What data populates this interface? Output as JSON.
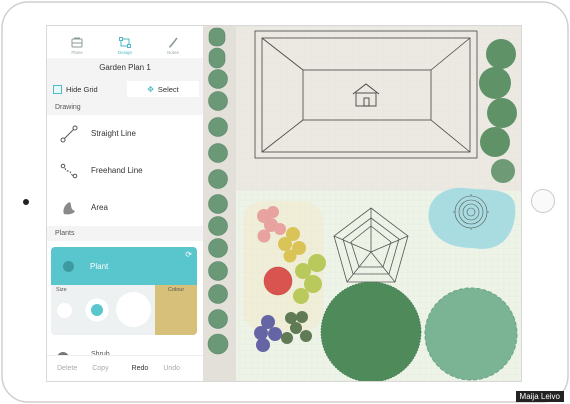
{
  "tabs": [
    {
      "label": "Plans",
      "icon": "plans-icon"
    },
    {
      "label": "Design",
      "icon": "design-icon"
    },
    {
      "label": "Notes",
      "icon": "notes-icon"
    }
  ],
  "plan_title": "Garden Plan 1",
  "hide_grid_label": "Hide Grid",
  "select_label": "Select",
  "drawing_section": "Drawing",
  "tools": [
    {
      "label": "Straight Line",
      "icon": "straight-line-icon"
    },
    {
      "label": "Freehand Line",
      "icon": "freehand-line-icon"
    },
    {
      "label": "Area",
      "icon": "area-icon"
    }
  ],
  "plants_section": "Plants",
  "plant": {
    "label": "Plant",
    "size_label": "Size",
    "colour_label": "Colour",
    "colour": "#d6c07a",
    "accent": "#59c6cd"
  },
  "shrub_label": "Shrub",
  "bottom_actions": [
    "Delete",
    "Copy",
    "Redo",
    "Undo"
  ],
  "credit": "Maija Leivo"
}
